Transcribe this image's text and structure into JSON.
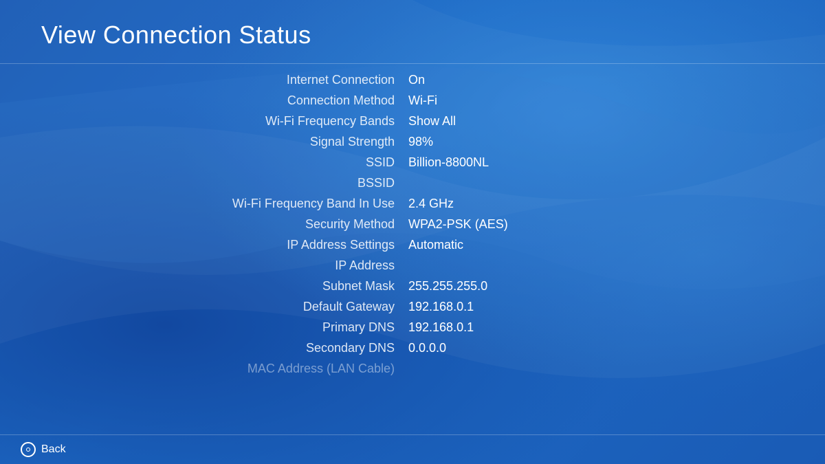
{
  "page": {
    "title": "View Connection Status"
  },
  "rows": [
    {
      "label": "Internet Connection",
      "value": "On"
    },
    {
      "label": "Connection Method",
      "value": "Wi-Fi"
    },
    {
      "label": "Wi-Fi Frequency Bands",
      "value": "Show All"
    },
    {
      "label": "Signal Strength",
      "value": "98%"
    },
    {
      "label": "SSID",
      "value": "Billion-8800NL"
    },
    {
      "label": "BSSID",
      "value": ""
    },
    {
      "label": "Wi-Fi Frequency Band In Use",
      "value": "2.4 GHz"
    },
    {
      "label": "Security Method",
      "value": "WPA2-PSK (AES)"
    },
    {
      "label": "IP Address Settings",
      "value": "Automatic"
    },
    {
      "label": "IP Address",
      "value": ""
    },
    {
      "label": "Subnet Mask",
      "value": "255.255.255.0"
    },
    {
      "label": "Default Gateway",
      "value": "192.168.0.1"
    },
    {
      "label": "Primary DNS",
      "value": "192.168.0.1"
    },
    {
      "label": "Secondary DNS",
      "value": "0.0.0.0"
    },
    {
      "label": "MAC Address (LAN Cable)",
      "value": "",
      "faded": true
    }
  ],
  "footer": {
    "back_label": "Back"
  }
}
